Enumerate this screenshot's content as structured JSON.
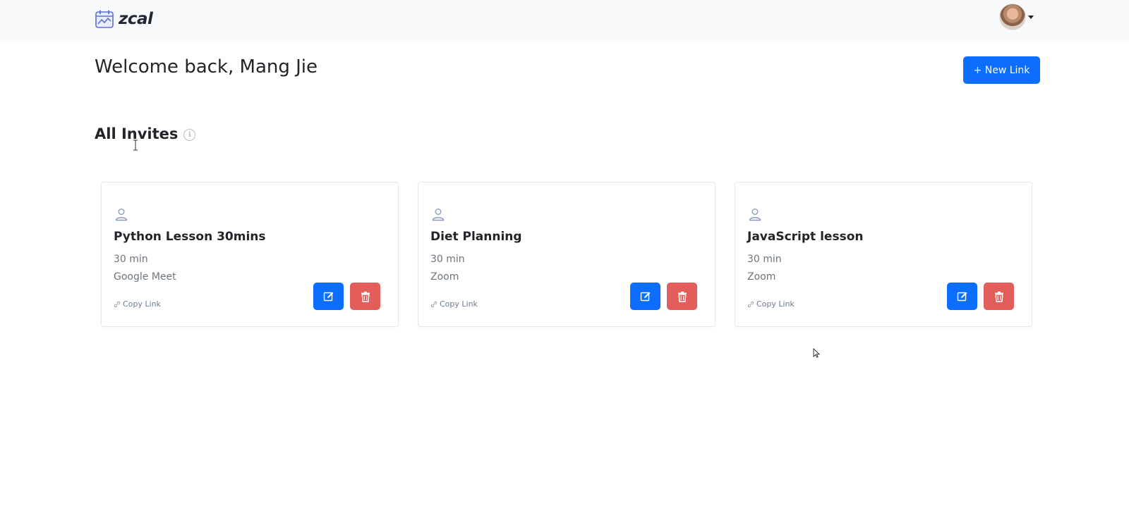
{
  "app": {
    "brand_name": "zcal",
    "accent_color": "#0d6efd",
    "danger_color": "#e35d5b"
  },
  "header": {
    "welcome": "Welcome back, Mang Jie",
    "new_link_label": "+ New Link"
  },
  "section": {
    "title": "All Invites",
    "info_icon": "info-circle-icon"
  },
  "invites": [
    {
      "title": "Python Lesson 30mins",
      "duration": "30 min",
      "location": "Google Meet",
      "copy_label": "Copy Link"
    },
    {
      "title": "Diet Planning",
      "duration": "30 min",
      "location": "Zoom",
      "copy_label": "Copy Link"
    },
    {
      "title": "JavaScript lesson",
      "duration": "30 min",
      "location": "Zoom",
      "copy_label": "Copy Link"
    }
  ],
  "icons": {
    "logo": "calendar-chart-icon",
    "person": "person-icon",
    "link": "link-icon",
    "edit": "edit-icon",
    "delete": "trash-icon"
  }
}
